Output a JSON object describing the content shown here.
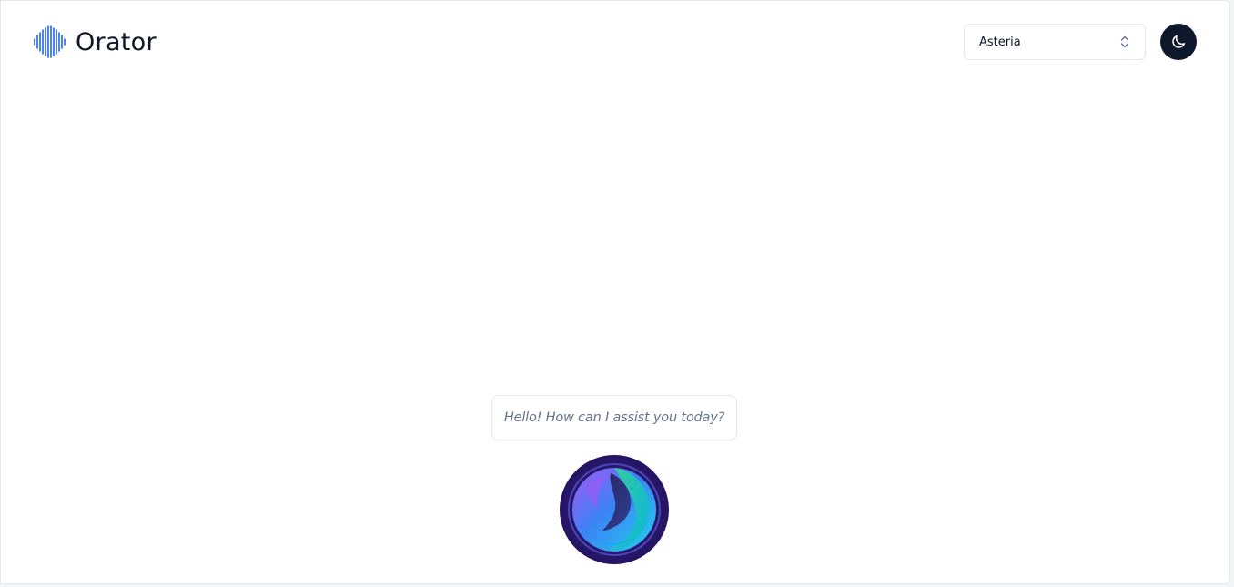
{
  "app": {
    "name": "Orator",
    "brand_icon": "waveform-icon"
  },
  "header": {
    "voice_select": {
      "selected": "Asteria",
      "icon": "chevrons-up-down-icon"
    },
    "theme_toggle": {
      "icon": "moon-icon"
    }
  },
  "conversation": {
    "greeting": "Hello! How can I assist you today?"
  },
  "colors": {
    "brand_blue": "#2563eb",
    "text_dark": "#0f172a",
    "text_muted": "#64748b",
    "avatar_ring": "#2e1a6e",
    "avatar_cyan": "#22d3ee",
    "avatar_violet": "#8b5cf6"
  }
}
